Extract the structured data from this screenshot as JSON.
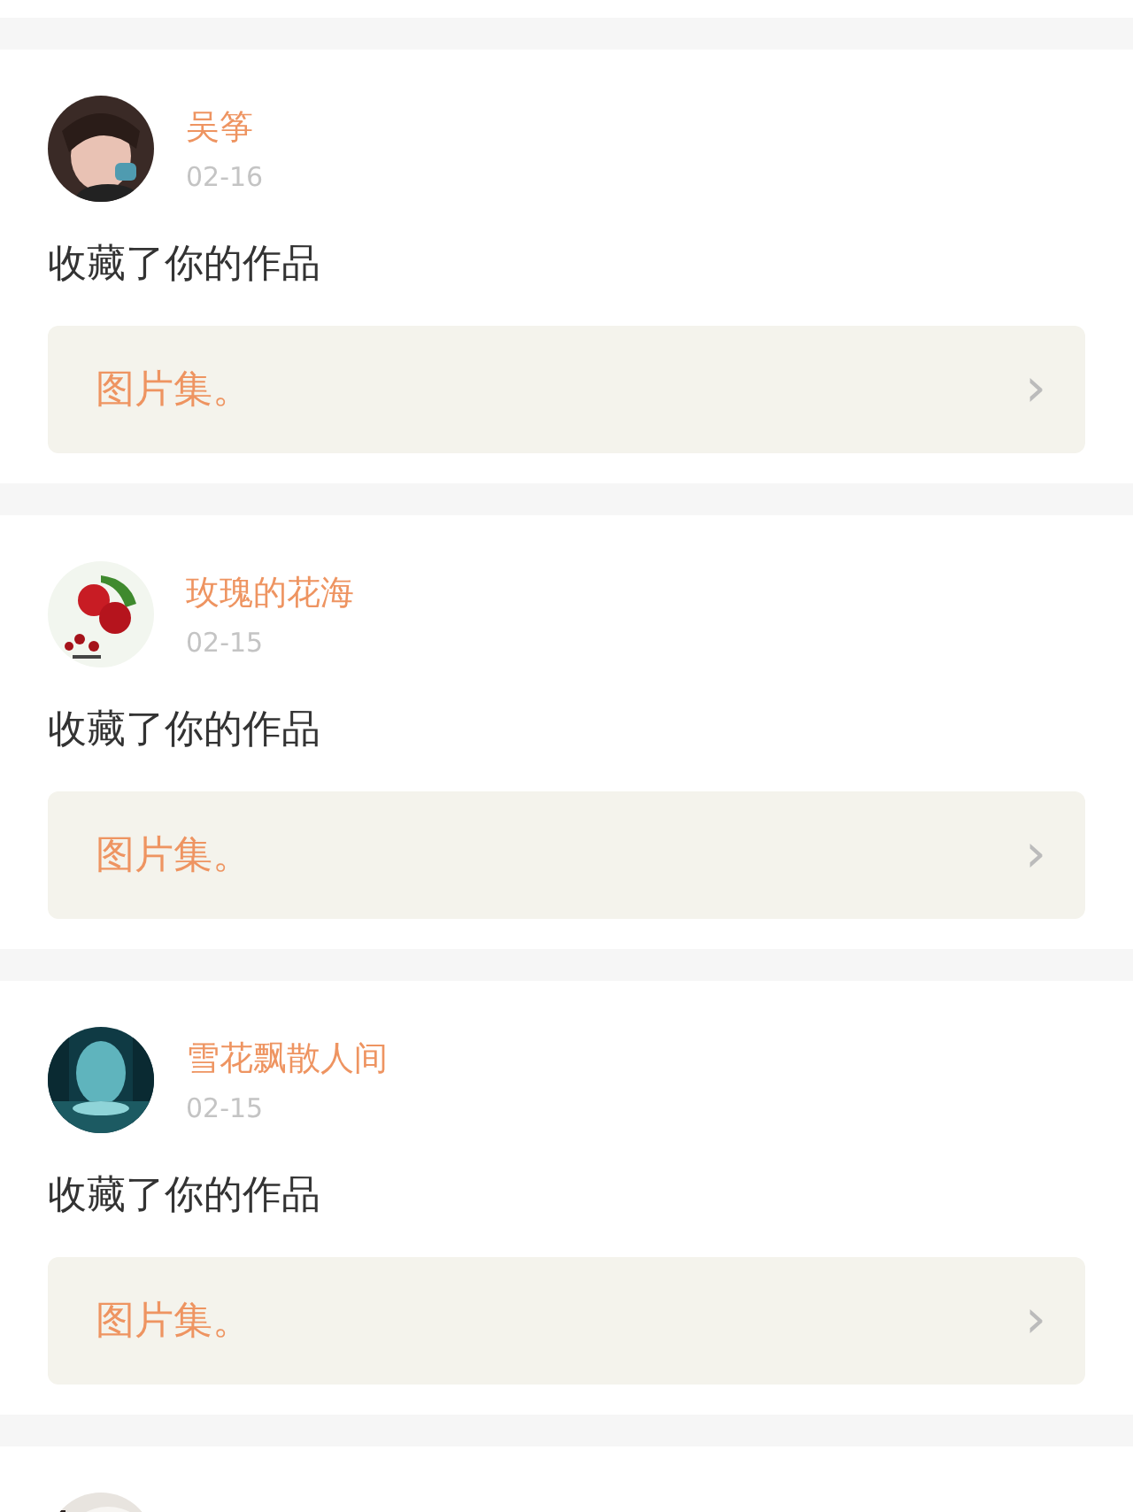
{
  "notifications": [
    {
      "avatar": {
        "kind": "picture"
      },
      "name": "吴筝",
      "date": "02-16",
      "action": "收藏了你的作品",
      "work": "图片集。",
      "chevron": "›"
    },
    {
      "avatar": {
        "kind": "picture"
      },
      "name": "玫瑰的花海",
      "date": "02-15",
      "action": "收藏了你的作品",
      "work": "图片集。",
      "chevron": "›"
    },
    {
      "avatar": {
        "kind": "picture"
      },
      "name": "雪花飘散人间",
      "date": "02-15",
      "action": "收藏了你的作品",
      "work": "图片集。",
      "chevron": "›"
    },
    {
      "avatar": {
        "kind": "picture"
      }
    }
  ]
}
